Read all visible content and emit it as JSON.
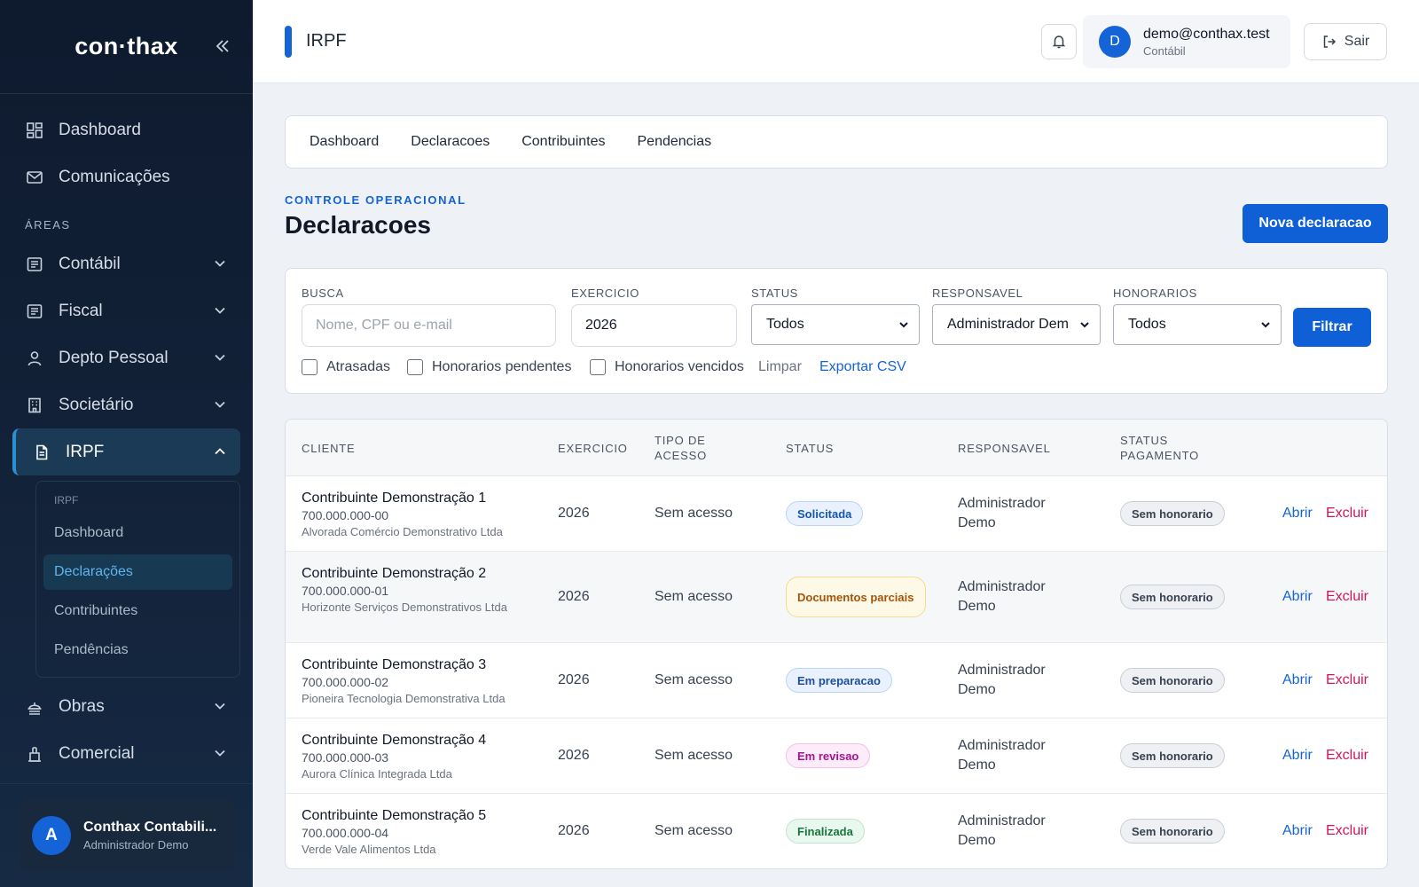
{
  "brand": {
    "logo": "con·thax"
  },
  "sidebar": {
    "top_items": [
      {
        "label": "Dashboard",
        "icon": "dashboard-icon"
      },
      {
        "label": "Comunicações",
        "icon": "mail-icon"
      }
    ],
    "section_label": "ÁREAS",
    "areas": [
      {
        "label": "Contábil",
        "icon": "ledger-icon"
      },
      {
        "label": "Fiscal",
        "icon": "receipt-icon"
      },
      {
        "label": "Depto Pessoal",
        "icon": "person-icon"
      },
      {
        "label": "Societário",
        "icon": "building-icon"
      },
      {
        "label": "IRPF",
        "icon": "document-icon"
      }
    ],
    "sub_label": "IRPF",
    "sub_items": [
      "Dashboard",
      "Declarações",
      "Contribuintes",
      "Pendências"
    ],
    "more_areas": [
      {
        "label": "Obras",
        "icon": "construction-icon"
      },
      {
        "label": "Comercial",
        "icon": "briefcase-icon"
      }
    ],
    "user": {
      "initial": "A",
      "name": "Conthax Contabili...",
      "role": "Administrador Demo"
    }
  },
  "topbar": {
    "title": "IRPF",
    "account": {
      "initial": "D",
      "email": "demo@conthax.test",
      "role": "Contábil"
    },
    "logout_label": "Sair"
  },
  "tabs": [
    "Dashboard",
    "Declaracoes",
    "Contribuintes",
    "Pendencias"
  ],
  "header": {
    "eyebrow": "CONTROLE OPERACIONAL",
    "title": "Declaracoes",
    "new_button": "Nova declaracao"
  },
  "filters": {
    "search": {
      "label": "BUSCA",
      "placeholder": "Nome, CPF ou e-mail"
    },
    "exercise": {
      "label": "EXERCICIO",
      "value": "2026"
    },
    "status": {
      "label": "STATUS",
      "value": "Todos"
    },
    "responsible": {
      "label": "RESPONSAVEL",
      "value": "Administrador Dem"
    },
    "fees": {
      "label": "HONORARIOS",
      "value": "Todos"
    },
    "filter_button": "Filtrar",
    "checkboxes": [
      "Atrasadas",
      "Honorarios pendentes",
      "Honorarios vencidos"
    ],
    "clear_label": "Limpar",
    "export_label": "Exportar CSV"
  },
  "table": {
    "headers": {
      "client": "CLIENTE",
      "exercise": "EXERCICIO",
      "access1": "TIPO DE",
      "access2": "ACESSO",
      "status": "STATUS",
      "responsible": "RESPONSAVEL",
      "pay1": "STATUS",
      "pay2": "PAGAMENTO"
    },
    "rows": [
      {
        "name": "Contribuinte Demonstração 1",
        "doc": "700.000.000-00",
        "company": "Alvorada Comércio Demonstrativo Ltda",
        "exercise": "2026",
        "access": "Sem acesso",
        "status": "Solicitada",
        "status_bg": "#e8f1fd",
        "status_fg": "#1557b0",
        "status_border": "#bcd4f5",
        "resp1": "Administrador",
        "resp2": "Demo",
        "payment": "Sem honorario",
        "open": "Abrir",
        "delete": "Excluir"
      },
      {
        "name": "Contribuinte Demonstração 2",
        "doc": "700.000.000-01",
        "company": "Horizonte Serviços Demonstrativos Ltda",
        "exercise": "2026",
        "access": "Sem acesso",
        "status": "Documentos parciais",
        "status_bg": "#fef9e6",
        "status_fg": "#a2550a",
        "status_border": "#f3dc8a",
        "resp1": "Administrador",
        "resp2": "Demo",
        "payment": "Sem honorario",
        "open": "Abrir",
        "delete": "Excluir"
      },
      {
        "name": "Contribuinte Demonstração 3",
        "doc": "700.000.000-02",
        "company": "Pioneira Tecnologia Demonstrativa Ltda",
        "exercise": "2026",
        "access": "Sem acesso",
        "status": "Em preparacao",
        "status_bg": "#e8f1fd",
        "status_fg": "#1e4f9c",
        "status_border": "#bcd4f5",
        "resp1": "Administrador",
        "resp2": "Demo",
        "payment": "Sem honorario",
        "open": "Abrir",
        "delete": "Excluir"
      },
      {
        "name": "Contribuinte Demonstração 4",
        "doc": "700.000.000-03",
        "company": "Aurora Clínica Integrada Ltda",
        "exercise": "2026",
        "access": "Sem acesso",
        "status": "Em revisao",
        "status_bg": "#fcebf8",
        "status_fg": "#a3158f",
        "status_border": "#f2c3e8",
        "resp1": "Administrador",
        "resp2": "Demo",
        "payment": "Sem honorario",
        "open": "Abrir",
        "delete": "Excluir"
      },
      {
        "name": "Contribuinte Demonstração 5",
        "doc": "700.000.000-04",
        "company": "Verde Vale Alimentos Ltda",
        "exercise": "2026",
        "access": "Sem acesso",
        "status": "Finalizada",
        "status_bg": "#e9f8ee",
        "status_fg": "#17763b",
        "status_border": "#bfe6cc",
        "resp1": "Administrador",
        "resp2": "Demo",
        "payment": "Sem honorario",
        "open": "Abrir",
        "delete": "Excluir"
      }
    ]
  }
}
